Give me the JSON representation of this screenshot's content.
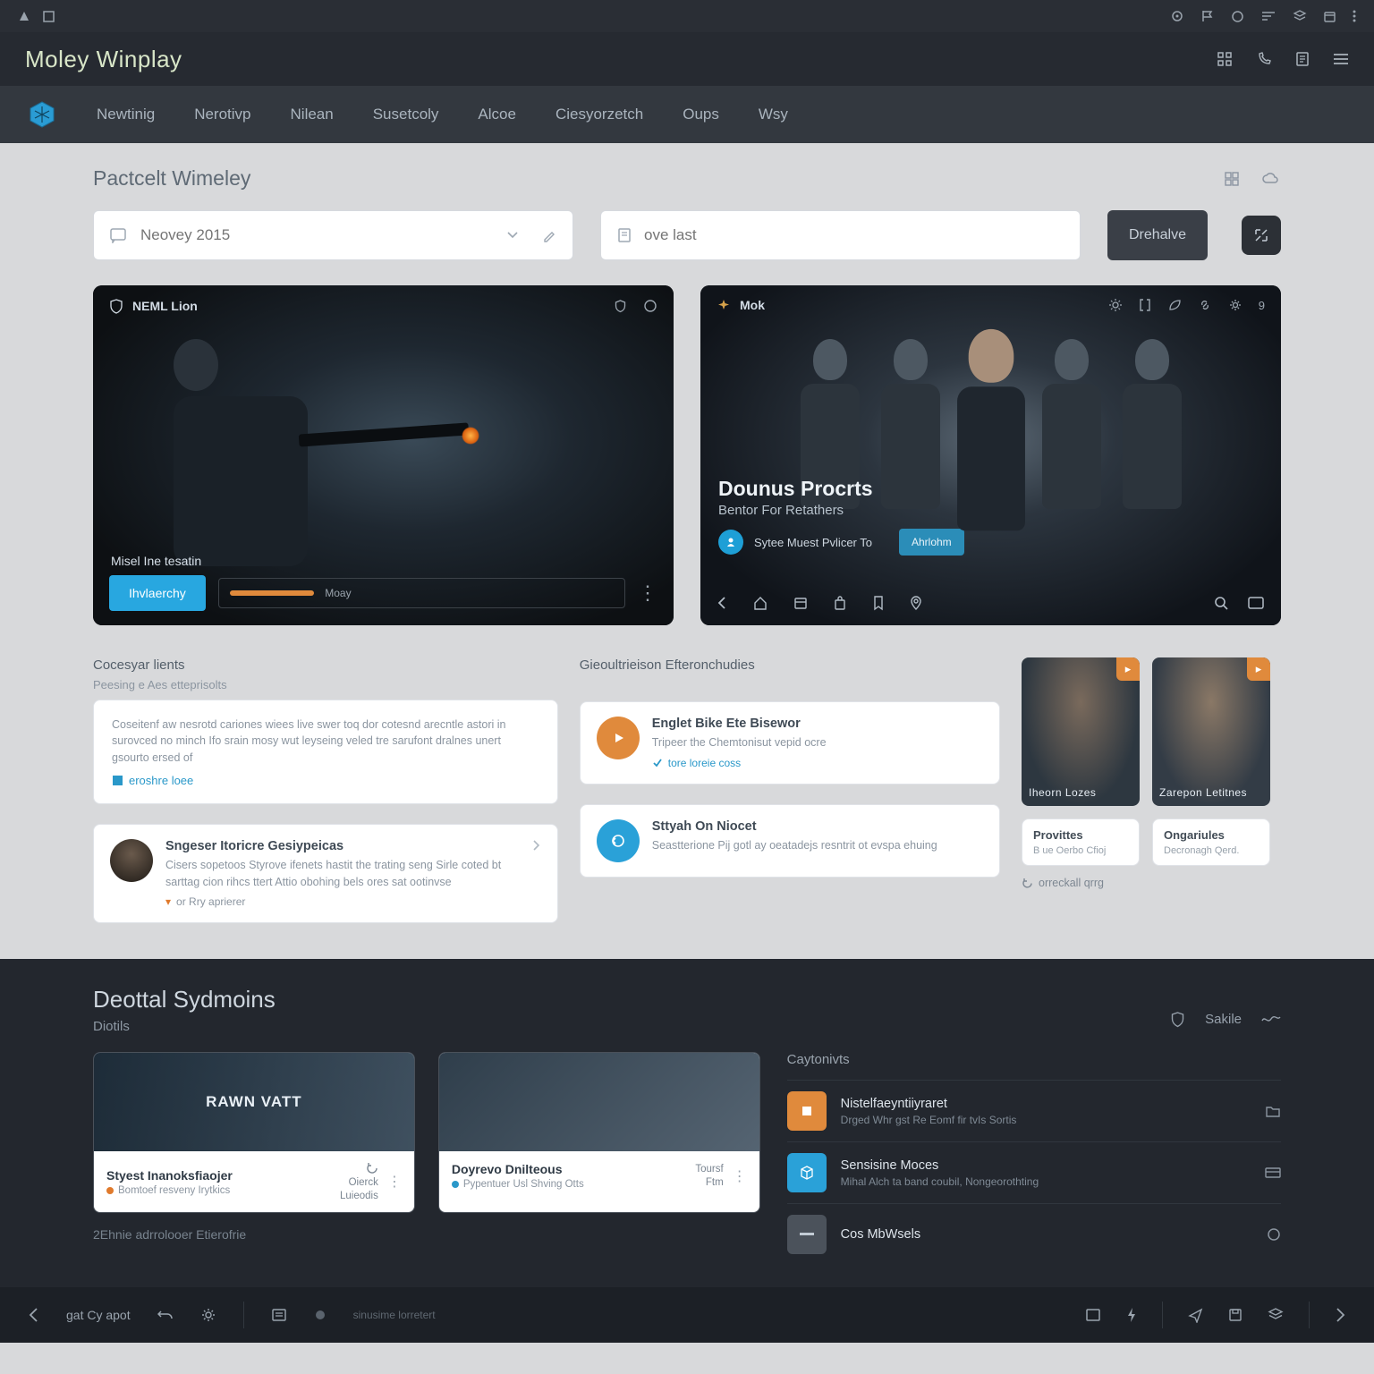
{
  "sysbar": {
    "icons_left": [
      "triangle",
      "square"
    ],
    "icons_right": [
      "target",
      "flag",
      "circle",
      "sort",
      "layers",
      "calendar",
      "more"
    ]
  },
  "titlebar": {
    "title": "Moley Winplay",
    "icons": [
      "grid",
      "phone",
      "doc",
      "menu"
    ]
  },
  "nav": {
    "items": [
      "Newtinig",
      "Nerotivp",
      "Nilean",
      "Susetcoly",
      "Alcoe",
      "Ciesyorzetch",
      "Oups",
      "Wsy"
    ]
  },
  "page": {
    "title": "Pactcelt Wimeley",
    "head_icons": [
      "grid",
      "cloud"
    ]
  },
  "search": {
    "left": {
      "icon": "message",
      "placeholder": "Neovey 2015"
    },
    "right": {
      "icon": "doc",
      "placeholder": "ove last"
    },
    "button": "Drehalve"
  },
  "heroA": {
    "badge": "NEML Lion",
    "subtitle": "Misel Ine tesatin",
    "cta": "Ihvlaerchy",
    "sliderLabel": "Moay"
  },
  "heroB": {
    "badge": "Mok",
    "midTitle": "Dounus Procrts",
    "midSub": "Bentor For Retathers",
    "pillText": "Sytee Muest Pvlicer To",
    "pillBtn": "Ahrlohm"
  },
  "leftcol": {
    "secTitle": "Cocesyar lients",
    "secSub": "Peesing e Aes etteprisolts",
    "para": "Coseitenf aw nesrotd cariones wiees live swer toq dor cotesnd arecntle astori in surovced no minch Ifo srain mosy wut leyseing veled tre sarufont dralnes unert gsourto ersed of",
    "link": "eroshre loee",
    "item2Title": "Sngeser Itoricre Gesiypeicas",
    "item2Body": "Cisers sopetoos Styrove ifenets hastit the trating seng Sirle coted bt sarttag cion rihcs ttert Attio obohing bels ores sat ootinvse",
    "item2Meta": "or Rry aprierer"
  },
  "midcol": {
    "secTitle": "Gieoultrieison Efteronchudies",
    "i1Title": "Englet Bike Ete Bisewor",
    "i1Sub": "Tripeer the Chemtonisut vepid ocre",
    "i1Meta": "tore loreie coss",
    "i2Title": "Sttyah On Niocet",
    "i2Sub": "Seastterione Pij gotl ay oeatadejs resntrit ot evspa ehuing"
  },
  "rightcol": {
    "tile1Tag": "Iheorn Lozes",
    "tile2Tag": "Zarepon Letitnes",
    "cap1Title": "Provittes",
    "cap1Sub": "B ue Oerbo Cfioj",
    "cap2Title": "Ongariules",
    "cap2Sub": "Decronagh Qerd.",
    "meta": "orreckall qrrg"
  },
  "lower": {
    "title": "Deottal Sydmoins",
    "sub": "Diotils",
    "rightLabel": "Sakile",
    "sidehead": "Caytonivts",
    "card1Title": "Styest Inanoksfiaojer",
    "card1Sub": "Bomtoef resveny Irytkics",
    "card1R1": "Oierck",
    "card1R2": "Luieodis",
    "card1Overlay": "RAWN VATT",
    "card2Title": "Doyrevo Dnilteous",
    "card2Sub": "Pypentuer Usl Shving Otts",
    "card2R1": "Toursf",
    "card2R2": "Ftm",
    "footnote": "2Ehnie adrrolooer Etierofrie",
    "s1Title": "Nistelfaeyntiiyraret",
    "s1Sub": "Drged Whr gst Re Eomf fir tvIs Sortis",
    "s2Title": "Sensisine Moces",
    "s2Sub": "Mihal Alch ta band coubil, Nongeorothting",
    "s3Title": "Cos MbWsels",
    "s3Sub": ""
  },
  "bottombar": {
    "label": "gat Cy apot",
    "hint": "sinusime lorretert"
  }
}
